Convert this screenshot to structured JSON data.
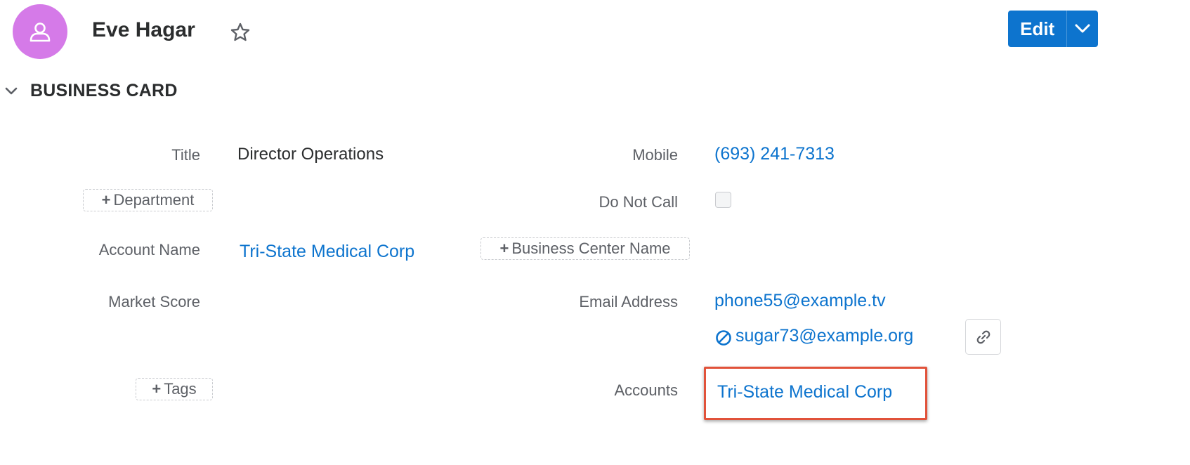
{
  "header": {
    "record_name": "Eve Hagar",
    "avatar_icon": "person-icon",
    "avatar_color": "#d57ae8",
    "edit_label": "Edit",
    "accent_color": "#0d74ce"
  },
  "section": {
    "title": "BUSINESS CARD"
  },
  "fields": {
    "title_label": "Title",
    "title_value": "Director Operations",
    "department_add": "Department",
    "account_name_label": "Account Name",
    "account_name_value": "Tri-State Medical Corp",
    "market_score_label": "Market Score",
    "tags_add": "Tags",
    "mobile_label": "Mobile",
    "mobile_value": "(693) 241-7313",
    "do_not_call_label": "Do Not Call",
    "do_not_call_checked": false,
    "business_center_add": "Business Center Name",
    "email_label": "Email Address",
    "email_primary": "phone55@example.tv",
    "email_secondary": "sugar73@example.org",
    "email_secondary_icon": "opt-out-icon",
    "accounts_label": "Accounts",
    "accounts_value": "Tri-State Medical Corp",
    "highlight_color": "#e1523a"
  }
}
